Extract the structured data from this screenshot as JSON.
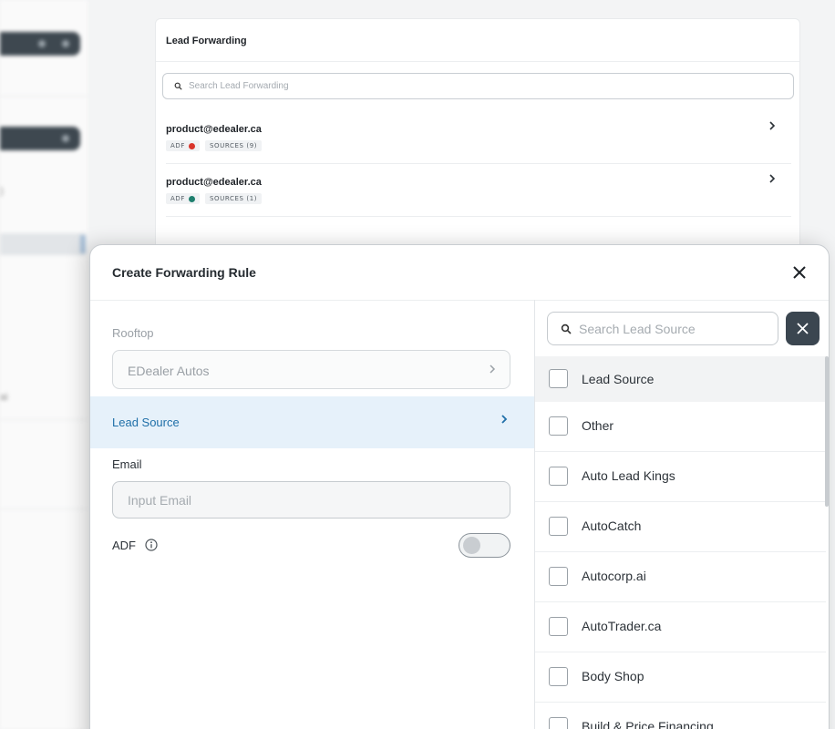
{
  "background": {
    "card": {
      "title": "Lead Forwarding",
      "search_placeholder": "Search Lead Forwarding",
      "rows": [
        {
          "email": "product@edealer.ca",
          "adf_label": "ADF",
          "adf_status": "error",
          "sources_label": "SOURCES (9)"
        },
        {
          "email": "product@edealer.ca",
          "adf_label": "ADF",
          "adf_status": "ok",
          "sources_label": "SOURCES (1)"
        }
      ]
    }
  },
  "modal": {
    "title": "Create Forwarding Rule",
    "rooftop": {
      "label": "Rooftop",
      "value": "EDealer Autos"
    },
    "lead_source": {
      "label": "Lead Source"
    },
    "email": {
      "label": "Email",
      "placeholder": "Input Email"
    },
    "adf": {
      "label": "ADF",
      "enabled": false
    },
    "source_search": {
      "placeholder": "Search Lead Source"
    },
    "sources": [
      {
        "name": "Lead Source",
        "checked": false,
        "header": true
      },
      {
        "name": "Other",
        "checked": false
      },
      {
        "name": "Auto Lead Kings",
        "checked": false
      },
      {
        "name": "AutoCatch",
        "checked": false
      },
      {
        "name": "Autocorp.ai",
        "checked": false
      },
      {
        "name": "AutoTrader.ca",
        "checked": false
      },
      {
        "name": "Body Shop",
        "checked": false
      },
      {
        "name": "Build & Price Financing",
        "checked": false
      }
    ]
  },
  "colors": {
    "accent": "#1f6fa8",
    "selected_row": "#e6f1fa",
    "dark_button": "#3b4650",
    "status_error": "#d9352b",
    "status_ok": "#1f7f6e"
  }
}
